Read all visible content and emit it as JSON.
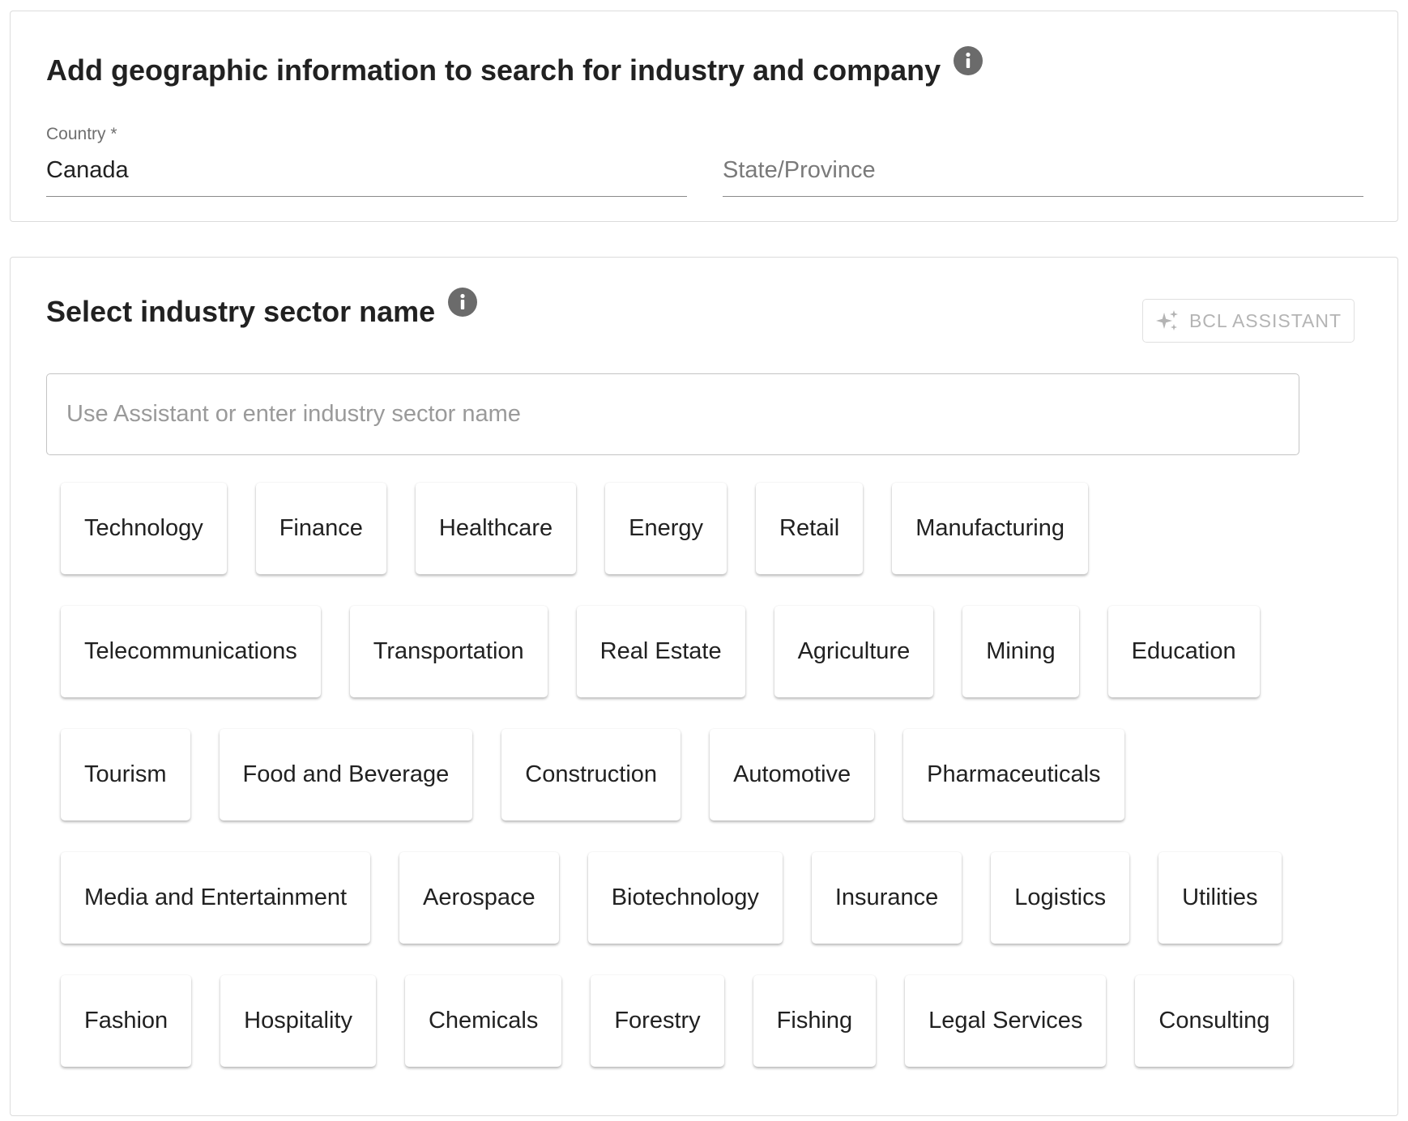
{
  "geo": {
    "title": "Add geographic information to search for industry and company",
    "info_icon": "info-icon",
    "country_label": "Country *",
    "country_value": "Canada",
    "state_placeholder": "State/Province"
  },
  "industry": {
    "title": "Select industry sector name",
    "info_icon": "info-icon",
    "assistant_label": "BCL ASSISTANT",
    "assistant_icon": "sparkle-icon",
    "input_placeholder": "Use Assistant or enter industry sector name",
    "chip_rows": [
      [
        "Technology",
        "Finance",
        "Healthcare",
        "Energy",
        "Retail",
        "Manufacturing"
      ],
      [
        "Telecommunications",
        "Transportation",
        "Real Estate",
        "Agriculture",
        "Mining",
        "Education"
      ],
      [
        "Tourism",
        "Food and Beverage",
        "Construction",
        "Automotive",
        "Pharmaceuticals"
      ],
      [
        "Media and Entertainment",
        "Aerospace",
        "Biotechnology",
        "Insurance",
        "Logistics",
        "Utilities"
      ],
      [
        "Fashion",
        "Hospitality",
        "Chemicals",
        "Forestry",
        "Fishing",
        "Legal Services",
        "Consulting"
      ]
    ]
  },
  "colors": {
    "text": "#212121",
    "muted": "#6f6f6f",
    "info_icon_bg": "#6b6b6b",
    "assistant_disabled": "#b4b4b4",
    "border": "#dcdcdc"
  }
}
